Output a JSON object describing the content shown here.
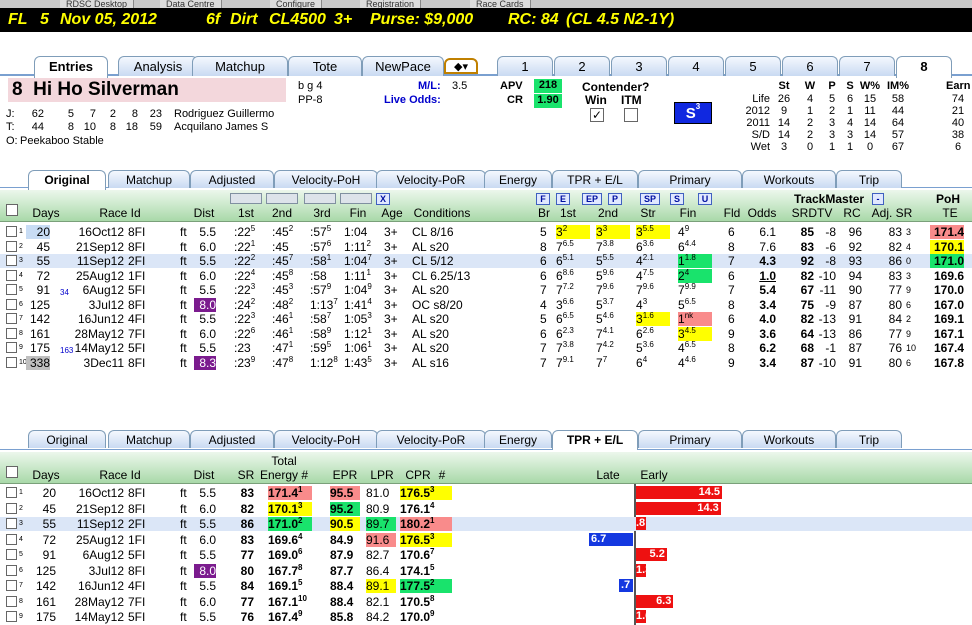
{
  "window": {
    "top_tabs": [
      "RDSC Desktop",
      "Data Centre",
      "Configure",
      "Registration",
      "Race Cards"
    ]
  },
  "banner": {
    "track": "FL",
    "race": "5",
    "date": "Nov 05, 2012",
    "dist": "6f",
    "surface": "Dirt",
    "class": "CL4500",
    "age": "3+",
    "purse": "Purse: $9,000",
    "rc": "RC: 84",
    "rc_detail": "(CL 4.5 N2-1Y)"
  },
  "main_tabs": {
    "left": [
      "Entries",
      "Analysis",
      "Matchup",
      "Tote",
      "NewPace"
    ],
    "numbers": [
      "1",
      "2",
      "3",
      "4",
      "5",
      "6",
      "7",
      "8"
    ],
    "active_left": "Entries",
    "active_number": "8"
  },
  "horse": {
    "number": "8",
    "name": "Hi Ho Silverman",
    "sex": "b g 4",
    "pp": "PP-8",
    "ml_label": "M/L:",
    "ml": "3.5",
    "live_odds_label": "Live Odds:",
    "apv_label": "APV",
    "apv": "218",
    "cr_label": "CR",
    "cr": "1.90",
    "contender_label": "Contender?",
    "win_label": "Win",
    "itm_label": "ITM",
    "win_checked": "✓",
    "s_badge": "S",
    "s_badge_num": "3",
    "jockey": {
      "label": "J:",
      "stats": [
        "62",
        "5",
        "7",
        "2",
        "8",
        "23"
      ],
      "name": "Rodriguez Guillermo"
    },
    "trainer": {
      "label": "T:",
      "stats": [
        "44",
        "8",
        "10",
        "8",
        "18",
        "59"
      ],
      "name": "Acquilano James S"
    },
    "owner": {
      "label": "O:",
      "name": "Peekaboo Stable"
    }
  },
  "stats_table": {
    "headers": [
      "St",
      "W",
      "P",
      "S",
      "W%",
      "IM%",
      "Earn"
    ],
    "rows": [
      [
        "Life",
        "26",
        "4",
        "5",
        "6",
        "15",
        "58",
        "74"
      ],
      [
        "2012",
        "9",
        "1",
        "2",
        "1",
        "11",
        "44",
        "21"
      ],
      [
        "2011",
        "14",
        "2",
        "3",
        "4",
        "14",
        "64",
        "40"
      ],
      [
        "S/D",
        "14",
        "2",
        "3",
        "3",
        "14",
        "57",
        "38"
      ],
      [
        "Wet",
        "3",
        "0",
        "1",
        "1",
        "0",
        "67",
        "6"
      ]
    ]
  },
  "sub_tabs": [
    "Original",
    "Matchup",
    "Adjusted",
    "Velocity-PoH",
    "Velocity-PoR",
    "Energy",
    "TPR + E/L",
    "Primary",
    "Workouts",
    "Trip"
  ],
  "upper": {
    "active_tab": "Original",
    "pace_buttons": [
      "X",
      "F",
      "E",
      "EP",
      "P",
      "SP",
      "S",
      "U"
    ],
    "headers": {
      "days": "Days",
      "race_id": "Race Id",
      "dist": "Dist",
      "c1": "1st",
      "c2": "2nd",
      "c3": "3rd",
      "fin": "Fin",
      "age": "Age",
      "cond": "Conditions",
      "br": "Br",
      "c1b": "1st",
      "c2b": "2nd",
      "str": "Str",
      "finb": "Fin",
      "fld": "Fld",
      "odds": "Odds",
      "tm": "TrackMaster",
      "srdtv": "SRDTV",
      "rc": "RC",
      "adjsr": "Adj. SR",
      "poh": "PoH",
      "te": "TE"
    },
    "rows": [
      {
        "n": "1",
        "days": "20",
        "date": "16Oct12",
        "rid": "8FI",
        "s": "ft",
        "dist": "5.5",
        "f1": ":22",
        "f1s": "5",
        "f2": ":45",
        "f2s": "2",
        "f3": ":57",
        "f3s": "5",
        "fin": "1:04",
        "age": "3+",
        "cond": "CL 8/16",
        "br": "5",
        "b1": "3",
        "b1s": "2",
        "b2": "3",
        "b2s": "3",
        "st": "3",
        "sts": "5.5",
        "bf": "4",
        "bfs": "9",
        "fld": "6",
        "odds": "6.1",
        "sr": "85",
        "dtv": "-8",
        "rc": "96",
        "adj": "83",
        "adjs": "3",
        "te": "171.4"
      },
      {
        "n": "2",
        "days": "45",
        "date": "21Sep12",
        "rid": "8FI",
        "s": "ft",
        "dist": "6.0",
        "f1": ":22",
        "f1s": "1",
        "f2": ":45",
        "f2s": "",
        "f3": ":57",
        "f3s": "6",
        "fin": "1:11",
        "fins": "2",
        "age": "3+",
        "cond": "AL s20",
        "br": "8",
        "b1": "7",
        "b1s": "6.5",
        "b2": "7",
        "b2s": "3.8",
        "st": "6",
        "sts": "3.6",
        "bf": "6",
        "bfs": "4.4",
        "fld": "8",
        "odds": "7.6",
        "sr": "83",
        "dtv": "-6",
        "rc": "92",
        "adj": "82",
        "adjs": "4",
        "te": "170.1"
      },
      {
        "n": "3",
        "days": "55",
        "date": "11Sep12",
        "rid": "2FI",
        "s": "ft",
        "dist": "5.5",
        "f1": ":22",
        "f1s": "2",
        "f2": ":45",
        "f2s": "7",
        "f3": ":58",
        "f3s": "1",
        "fin": "1:04",
        "fins": "7",
        "age": "3+",
        "cond": "CL 5/12",
        "br": "6",
        "b1": "6",
        "b1s": "5.1",
        "b2": "5",
        "b2s": "5.5",
        "st": "4",
        "sts": "2.1",
        "bf": "1",
        "bfs": "1.8",
        "fld": "7",
        "odds": "4.3",
        "sr": "92",
        "dtv": "-8",
        "rc": "93",
        "adj": "86",
        "adjs": "0",
        "te": "171.0"
      },
      {
        "n": "4",
        "days": "72",
        "date": "25Aug12",
        "rid": "1FI",
        "s": "ft",
        "dist": "6.0",
        "f1": ":22",
        "f1s": "4",
        "f2": ":45",
        "f2s": "8",
        "f3": ":58",
        "f3s": "",
        "fin": "1:11",
        "fins": "1",
        "age": "3+",
        "cond": "CL 6.25/13",
        "br": "6",
        "b1": "6",
        "b1s": "8.6",
        "b2": "5",
        "b2s": "9.6",
        "st": "4",
        "sts": "7.5",
        "bf": "2",
        "bfs": "4",
        "fld": "6",
        "odds": "1.0",
        "sr": "82",
        "dtv": "-10",
        "rc": "94",
        "adj": "83",
        "adjs": "3",
        "te": "169.6"
      },
      {
        "n": "5",
        "days": "91",
        "days_sup": "34",
        "date": "6Aug12",
        "rid": "5FI",
        "s": "ft",
        "dist": "5.5",
        "f1": ":22",
        "f1s": "3",
        "f2": ":45",
        "f2s": "3",
        "f3": ":57",
        "f3s": "9",
        "fin": "1:04",
        "fins": "9",
        "age": "3+",
        "cond": "AL s20",
        "br": "7",
        "b1": "7",
        "b1s": "7.2",
        "b2": "7",
        "b2s": "9.6",
        "st": "7",
        "sts": "9.6",
        "bf": "7",
        "bfs": "9.9",
        "fld": "7",
        "odds": "5.4",
        "sr": "67",
        "dtv": "-11",
        "rc": "90",
        "adj": "77",
        "adjs": "9",
        "te": "170.0"
      },
      {
        "n": "6",
        "days": "125",
        "date": "3Jul12",
        "rid": "8FI",
        "s": "ft",
        "dist": "8.0",
        "f1": ":24",
        "f1s": "2",
        "f2": ":48",
        "f2s": "2",
        "f3": "1:13",
        "f3s": "7",
        "fin": "1:41",
        "fins": "4",
        "age": "3+",
        "cond": "OC s8/20",
        "br": "4",
        "b1": "3",
        "b1s": "6.6",
        "b2": "5",
        "b2s": "3.7",
        "st": "4",
        "sts": "3",
        "bf": "5",
        "bfs": "6.5",
        "fld": "8",
        "odds": "3.4",
        "sr": "75",
        "dtv": "-9",
        "rc": "87",
        "adj": "80",
        "adjs": "6",
        "te": "167.0"
      },
      {
        "n": "7",
        "days": "142",
        "date": "16Jun12",
        "rid": "4FI",
        "s": "ft",
        "dist": "5.5",
        "f1": ":22",
        "f1s": "3",
        "f2": ":46",
        "f2s": "1",
        "f3": ":58",
        "f3s": "7",
        "fin": "1:05",
        "fins": "3",
        "age": "3+",
        "cond": "AL s20",
        "br": "5",
        "b1": "6",
        "b1s": "6.5",
        "b2": "5",
        "b2s": "4.6",
        "st": "3",
        "sts": "1.6",
        "bf": "1",
        "bfs": "nk",
        "fld": "6",
        "odds": "4.0",
        "sr": "82",
        "dtv": "-13",
        "rc": "91",
        "adj": "84",
        "adjs": "2",
        "te": "169.1"
      },
      {
        "n": "8",
        "days": "161",
        "date": "28May12",
        "rid": "7FI",
        "s": "ft",
        "dist": "6.0",
        "f1": ":22",
        "f1s": "6",
        "f2": ":46",
        "f2s": "1",
        "f3": ":58",
        "f3s": "9",
        "fin": "1:12",
        "fins": "1",
        "age": "3+",
        "cond": "AL s20",
        "br": "6",
        "b1": "6",
        "b1s": "2.3",
        "b2": "7",
        "b2s": "4.1",
        "st": "6",
        "sts": "2.6",
        "bf": "3",
        "bfs": "4.5",
        "fld": "9",
        "odds": "3.6",
        "sr": "64",
        "dtv": "-13",
        "rc": "86",
        "adj": "77",
        "adjs": "9",
        "te": "167.1"
      },
      {
        "n": "9",
        "days": "175",
        "days_sup": "163",
        "date": "14May12",
        "rid": "5FI",
        "s": "ft",
        "dist": "5.5",
        "f1": ":23",
        "f1s": "",
        "f2": ":47",
        "f2s": "1",
        "f3": ":59",
        "f3s": "5",
        "fin": "1:06",
        "fins": "1",
        "age": "3+",
        "cond": "AL s20",
        "br": "7",
        "b1": "7",
        "b1s": "3.8",
        "b2": "7",
        "b2s": "4.2",
        "st": "5",
        "sts": "3.6",
        "bf": "4",
        "bfs": "6.5",
        "fld": "8",
        "odds": "6.2",
        "sr": "68",
        "dtv": "-1",
        "rc": "87",
        "adj": "76",
        "adjs": "10",
        "te": "167.4"
      },
      {
        "n": "10",
        "days": "338",
        "date": "3Dec11",
        "rid": "8FI",
        "s": "ft",
        "dist": "8.3",
        "f1": ":23",
        "f1s": "9",
        "f2": ":47",
        "f2s": "8",
        "f3": "1:12",
        "f3s": "8",
        "fin": "1:43",
        "fins": "5",
        "age": "3+",
        "cond": "AL s16",
        "br": "7",
        "b1": "7",
        "b1s": "9.1",
        "b2": "7",
        "b2s": "7",
        "st": "6",
        "sts": "4",
        "bf": "4",
        "bfs": "4.6",
        "fld": "9",
        "odds": "3.4",
        "sr": "87",
        "dtv": "-10",
        "rc": "91",
        "adj": "80",
        "adjs": "6",
        "te": "167.8"
      }
    ]
  },
  "lower": {
    "active_tab": "TPR + E/L",
    "headers": {
      "days": "Days",
      "race_id": "Race Id",
      "dist": "Dist",
      "sr": "SR",
      "total": "Total",
      "energy": "Energy #",
      "epr": "EPR",
      "lpr": "LPR",
      "cpr": "CPR",
      "num": "#",
      "late": "Late",
      "early": "Early"
    },
    "rows": [
      {
        "n": "1",
        "days": "20",
        "date": "16Oct12",
        "rid": "8FI",
        "s": "ft",
        "dist": "5.5",
        "sr": "83",
        "en": "171.4",
        "ens": "1",
        "epr": "95.5",
        "lpr": "81.0",
        "cpr": "176.5",
        "cprs": "3",
        "late": null,
        "early": 14.5
      },
      {
        "n": "2",
        "days": "45",
        "date": "21Sep12",
        "rid": "8FI",
        "s": "ft",
        "dist": "6.0",
        "sr": "82",
        "en": "170.1",
        "ens": "3",
        "epr": "95.2",
        "lpr": "80.9",
        "cpr": "176.1",
        "cprs": "4",
        "late": null,
        "early": 14.3
      },
      {
        "n": "3",
        "days": "55",
        "date": "11Sep12",
        "rid": "2FI",
        "s": "ft",
        "dist": "5.5",
        "sr": "86",
        "en": "171.0",
        "ens": "2",
        "epr": "90.5",
        "lpr": "89.7",
        "cpr": "180.2",
        "cprs": "1",
        "late": null,
        "early": 0.8
      },
      {
        "n": "4",
        "days": "72",
        "date": "25Aug12",
        "rid": "1FI",
        "s": "ft",
        "dist": "6.0",
        "sr": "83",
        "en": "169.6",
        "ens": "4",
        "epr": "84.9",
        "lpr": "91.6",
        "cpr": "176.5",
        "cprs": "3",
        "late": 6.7,
        "early": null
      },
      {
        "n": "5",
        "days": "91",
        "date": "6Aug12",
        "rid": "5FI",
        "s": "ft",
        "dist": "5.5",
        "sr": "77",
        "en": "169.0",
        "ens": "6",
        "epr": "87.9",
        "lpr": "82.7",
        "cpr": "170.6",
        "cprs": "7",
        "late": null,
        "early": 5.2
      },
      {
        "n": "6",
        "days": "125",
        "date": "3Jul12",
        "rid": "8FI",
        "s": "ft",
        "dist": "8.0",
        "sr": "80",
        "en": "167.7",
        "ens": "8",
        "epr": "87.7",
        "lpr": "86.4",
        "cpr": "174.1",
        "cprs": "5",
        "late": null,
        "early": 1.3
      },
      {
        "n": "7",
        "days": "142",
        "date": "16Jun12",
        "rid": "4FI",
        "s": "ft",
        "dist": "5.5",
        "sr": "84",
        "en": "169.1",
        "ens": "5",
        "epr": "88.4",
        "lpr": "89.1",
        "cpr": "177.5",
        "cprs": "2",
        "late": 0.7,
        "early": null
      },
      {
        "n": "8",
        "days": "161",
        "date": "28May12",
        "rid": "7FI",
        "s": "ft",
        "dist": "6.0",
        "sr": "77",
        "en": "167.1",
        "ens": "10",
        "epr": "88.4",
        "lpr": "82.1",
        "cpr": "170.5",
        "cprs": "8",
        "late": null,
        "early": 6.3
      },
      {
        "n": "9",
        "days": "175",
        "date": "14May12",
        "rid": "5FI",
        "s": "ft",
        "dist": "5.5",
        "sr": "76",
        "en": "167.4",
        "ens": "9",
        "epr": "85.8",
        "lpr": "84.2",
        "cpr": "170.0",
        "cprs": "9",
        "late": null,
        "early": 1.6
      }
    ]
  },
  "colors": {
    "banner_text": "#ffff00",
    "highlight_yellow": "#ffff00",
    "highlight_green": "#19e36c",
    "highlight_pink": "#f98b8b",
    "purple": "#7b1b8e",
    "early_bar": "#ee1111",
    "late_bar": "#1438e0"
  }
}
